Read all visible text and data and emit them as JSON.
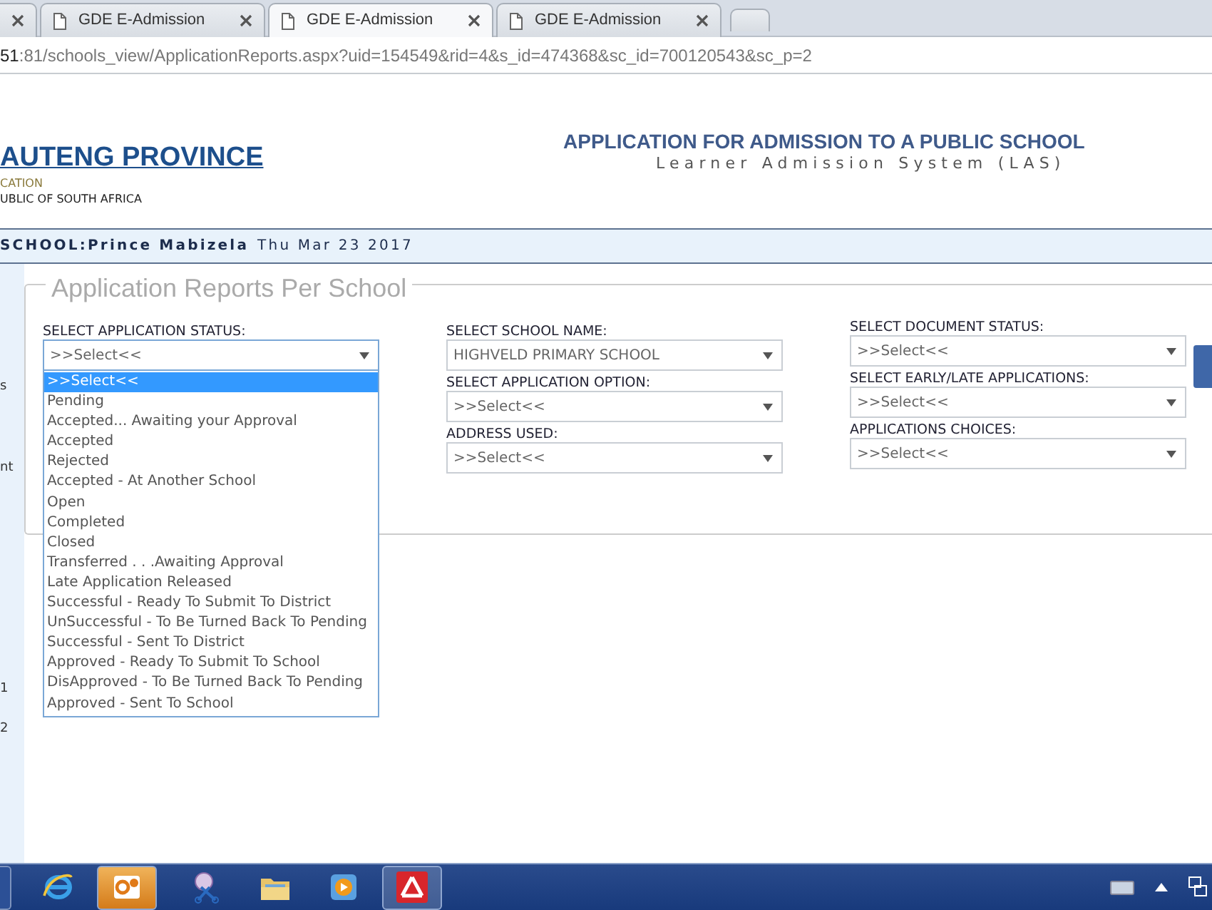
{
  "browser": {
    "tabs": [
      {
        "title": "GDE E-Admission",
        "selected": false
      },
      {
        "title": "GDE E-Admission",
        "selected": true
      },
      {
        "title": "GDE E-Admission",
        "selected": false
      }
    ],
    "address": {
      "host": "51",
      "path": ":81/schools_view/ApplicationReports.aspx?uid=154549&rid=4&s_id=474368&sc_id=700120543&sc_p=2"
    }
  },
  "header": {
    "logo_title": "AUTENG PROVINCE",
    "logo_line_1": "CATION",
    "logo_line_2": "UBLIC OF SOUTH AFRICA",
    "title": "APPLICATION FOR ADMISSION TO A PUBLIC SCHOOL",
    "subtitle": "Learner Admission System (LAS)"
  },
  "school_bar": {
    "school": "SCHOOL:Prince Mabizela",
    "date": "Thu Mar 23 2017"
  },
  "sidebar": [
    "s",
    "nt",
    "1",
    "2"
  ],
  "report": {
    "legend": "Application Reports Per School",
    "columns": [
      [
        {
          "label": "SELECT APPLICATION STATUS:",
          "value": ">>Select<<",
          "open": true,
          "options": [
            {
              "text": ">>Select<<",
              "selected": true
            },
            {
              "text": "Pending",
              "selected": false
            },
            {
              "text": "Accepted... Awaiting your Approval",
              "selected": false
            },
            {
              "text": "Accepted",
              "selected": false
            },
            {
              "text": "Rejected",
              "selected": false
            },
            {
              "text": "Accepted - At Another School",
              "selected": false
            },
            {
              "text": "Open",
              "selected": false
            },
            {
              "text": "Completed",
              "selected": false
            },
            {
              "text": "Closed",
              "selected": false
            },
            {
              "text": "Transferred . . .Awaiting Approval",
              "selected": false
            },
            {
              "text": "Late Application Released",
              "selected": false
            },
            {
              "text": "Successful - Ready To Submit To District",
              "selected": false
            },
            {
              "text": "UnSuccessful - To Be Turned Back To Pending",
              "selected": false
            },
            {
              "text": "Successful - Sent To District",
              "selected": false
            },
            {
              "text": "Approved - Ready To Submit To School",
              "selected": false
            },
            {
              "text": "DisApproved - To Be Turned Back To Pending",
              "selected": false
            },
            {
              "text": "Approved - Sent To School",
              "selected": false
            }
          ]
        }
      ],
      [
        {
          "label": "SELECT SCHOOL NAME:",
          "value": "HIGHVELD PRIMARY SCHOOL",
          "open": false
        },
        {
          "label": "SELECT APPLICATION OPTION:",
          "value": ">>Select<<",
          "open": false
        },
        {
          "label": "ADDRESS USED:",
          "value": ">>Select<<",
          "open": false
        }
      ],
      [
        {
          "label": "SELECT DOCUMENT STATUS:",
          "value": ">>Select<<",
          "open": false
        },
        {
          "label": "SELECT EARLY/LATE APPLICATIONS:",
          "value": ">>Select<<",
          "open": false
        },
        {
          "label": "APPLICATIONS CHOICES:",
          "value": ">>Select<<",
          "open": false
        }
      ]
    ]
  },
  "taskbar": {
    "apps": [
      {
        "kind": "ie",
        "selected": false
      },
      {
        "kind": "mail",
        "selected": true
      },
      {
        "kind": "scissors",
        "selected": false
      },
      {
        "kind": "folder",
        "selected": false
      },
      {
        "kind": "player",
        "selected": false
      },
      {
        "kind": "app",
        "selected": true
      }
    ]
  }
}
